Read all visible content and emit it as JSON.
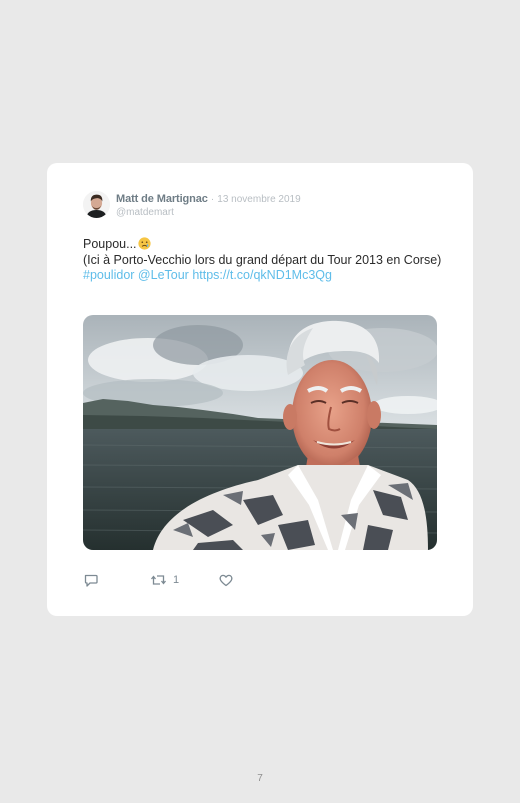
{
  "tweet": {
    "author_name": "Matt de Martignac",
    "separator": "·",
    "date": "13 novembre 2019",
    "handle": "@matdemart",
    "text_line1": "Poupou...",
    "text_line2": "(Ici à Porto-Vecchio lors du grand départ du Tour 2013 en Corse)",
    "hashtag": "#poulidor",
    "mention": "@LeTour",
    "link": "https://t.co/qkND1Mc3Qg",
    "emoji_icon": "crying-face-emoji",
    "photo_description_icon": "photo-icon",
    "actions": {
      "reply_icon": "reply-icon",
      "retweet_icon": "retweet-icon",
      "retweet_count": "1",
      "like_icon": "heart-icon"
    }
  },
  "page": {
    "number": "7"
  },
  "colors": {
    "background": "#e9e9e9",
    "card": "#ffffff",
    "link": "#5fbde9",
    "author": "#6f7d86",
    "muted": "#b8bec3"
  }
}
